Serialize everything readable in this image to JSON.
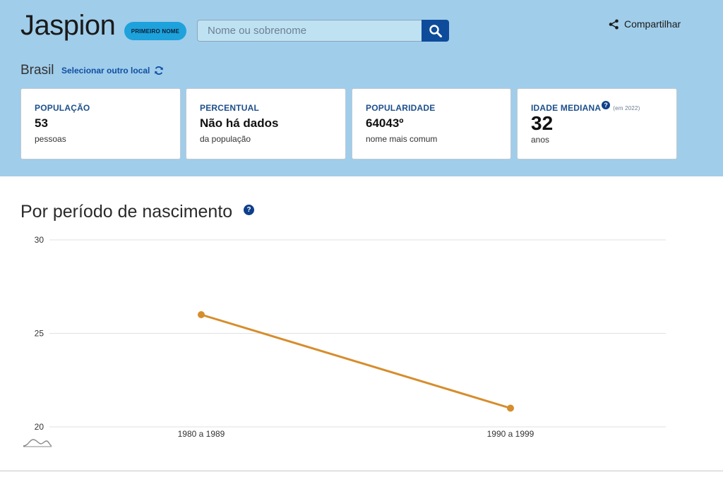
{
  "header": {
    "name": "Jaspion",
    "badge": "PRIMEIRO NOME",
    "search_placeholder": "Nome ou sobrenome",
    "share_label": "Compartilhar",
    "location": "Brasil",
    "change_location": "Selecionar outro local"
  },
  "cards": [
    {
      "label": "POPULAÇÃO",
      "value": "53",
      "sub": "pessoas"
    },
    {
      "label": "PERCENTUAL",
      "value": "Não há dados",
      "sub": "da população"
    },
    {
      "label": "POPULARIDADE",
      "value": "64043º",
      "sub": "nome mais comum"
    },
    {
      "label": "IDADE MEDIANA",
      "note": "(em 2022)",
      "value": "32",
      "sub": "anos"
    }
  ],
  "section": {
    "title": "Por período de nascimento"
  },
  "colors": {
    "hero_bg": "#a0cdea",
    "accent": "#0e4c9b",
    "badge": "#1ea2dc",
    "line": "#d68d2c"
  },
  "chart_data": {
    "type": "line",
    "categories": [
      "1980 a 1989",
      "1990 a 1999"
    ],
    "series": [
      {
        "values": [
          26,
          21
        ]
      }
    ],
    "ylim": [
      20,
      30
    ],
    "yticks": [
      20,
      25,
      30
    ],
    "grid": true
  }
}
